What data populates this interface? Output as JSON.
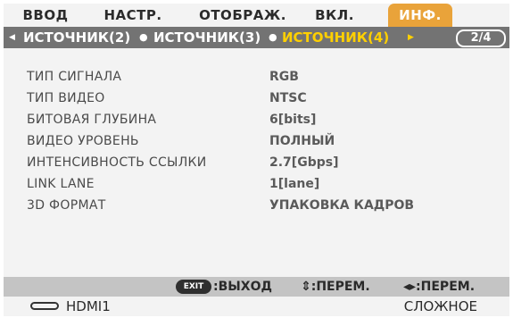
{
  "tabs": [
    {
      "label": "ВВОД"
    },
    {
      "label": "НАСТР."
    },
    {
      "label": "ОТОБРАЖ."
    },
    {
      "label": "ВКЛ."
    },
    {
      "label": "ИНФ."
    }
  ],
  "active_tab": "ИНФ.",
  "subtabs": [
    {
      "label": "ИСТОЧНИК(2)"
    },
    {
      "label": "ИСТОЧНИК(3)"
    },
    {
      "label": "ИСТОЧНИК(4)"
    }
  ],
  "current_subtab": "ИСТОЧНИК(4)",
  "page_indicator": "2/4",
  "info": [
    {
      "label": "ТИП СИГНАЛА",
      "value": "RGB"
    },
    {
      "label": "ТИП ВИДЕО",
      "value": "NTSC"
    },
    {
      "label": "БИТОВАЯ ГЛУБИНА",
      "value": "6[bits]"
    },
    {
      "label": "ВИДЕО УРОВЕНЬ",
      "value": "ПОЛНЫЙ"
    },
    {
      "label": "ИНТЕНСИВНОСТЬ ССЫЛКИ",
      "value": "2.7[Gbps]"
    },
    {
      "label": "LINK LANE",
      "value": "1[lane]"
    },
    {
      "label": "3D ФОРМАТ",
      "value": "УПАКОВКА КАДРОВ"
    }
  ],
  "guide": {
    "exit_key": "EXIT",
    "exit_label": ":ВЫХОД",
    "updown": "⇕:ПЕРЕМ.",
    "leftright": "◂▸:ПЕРЕМ."
  },
  "status": {
    "source": "HDMI1",
    "mode": "СЛОЖНОЕ"
  },
  "colors": {
    "active_tab": "#e9a33a",
    "subbar": "#737373",
    "current_subtab": "#ffd000",
    "panel": "#f3f3f3",
    "guide_bar": "#c4c4c4"
  },
  "icons": {
    "left_arrow": "triangle-left-icon",
    "right_arrow": "triangle-right-icon",
    "connector": "hdmi-connector-icon"
  }
}
